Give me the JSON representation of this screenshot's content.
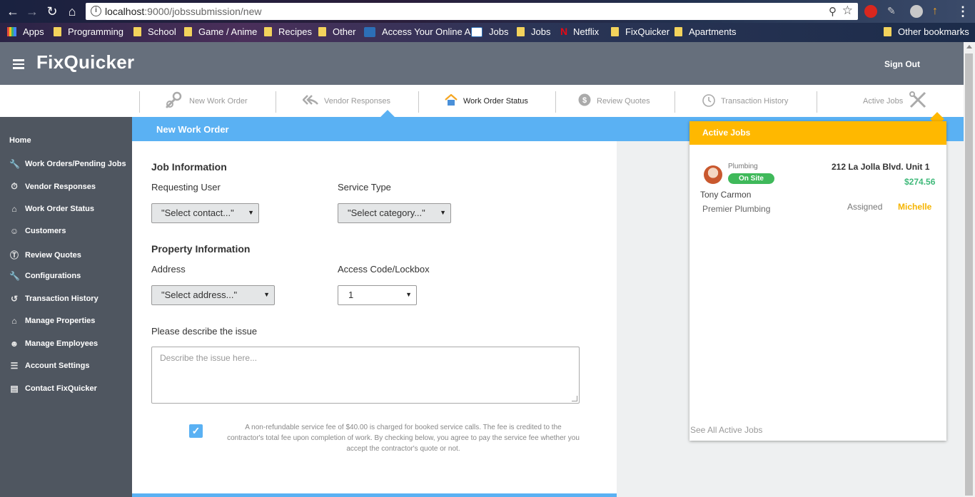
{
  "browser": {
    "url_host": "localhost",
    "url_rest": ":9000/jobssubmission/new",
    "bookmarks": [
      {
        "label": "Apps",
        "kind": "apps"
      },
      {
        "label": "Programming",
        "kind": "folder"
      },
      {
        "label": "School",
        "kind": "folder"
      },
      {
        "label": "Game / Anime",
        "kind": "folder"
      },
      {
        "label": "Recipes",
        "kind": "folder"
      },
      {
        "label": "Other",
        "kind": "folder"
      },
      {
        "label": "Access Your Online A",
        "kind": "site"
      },
      {
        "label": "Jobs",
        "kind": "site"
      },
      {
        "label": "Jobs",
        "kind": "folder"
      },
      {
        "label": "Netflix",
        "kind": "netflix"
      },
      {
        "label": "FixQuicker",
        "kind": "folder"
      },
      {
        "label": "Apartments",
        "kind": "folder"
      }
    ],
    "other_bookmarks": "Other bookmarks"
  },
  "header": {
    "brand": "FixQuicker",
    "sign_out": "Sign Out"
  },
  "tabs": [
    {
      "label": "New Work Order",
      "icon": "wrench-gear-icon",
      "active": false
    },
    {
      "label": "Vendor Responses",
      "icon": "reply-all-icon",
      "active": false
    },
    {
      "label": "Work Order Status",
      "icon": "house-icon",
      "active": true
    },
    {
      "label": "Review Quotes",
      "icon": "dollar-circle-icon",
      "active": false
    },
    {
      "label": "Transaction History",
      "icon": "history-icon",
      "active": false
    },
    {
      "label": "Active Jobs",
      "icon": "tools-icon",
      "active": false
    }
  ],
  "sidebar": {
    "items": [
      {
        "label": "Home",
        "icon": ""
      },
      {
        "label": "Work Orders/Pending Jobs",
        "icon": "wrench-icon"
      },
      {
        "label": "Vendor Responses",
        "icon": "stopwatch-icon"
      },
      {
        "label": "Work Order Status",
        "icon": "home-icon"
      },
      {
        "label": "Customers",
        "icon": "users-icon"
      },
      {
        "label": "Review Quotes",
        "icon": "dollar-icon"
      },
      {
        "label": "Configurations",
        "icon": "wrench-icon"
      },
      {
        "label": "Transaction History",
        "icon": "history-icon"
      },
      {
        "label": "Manage Properties",
        "icon": "building-icon"
      },
      {
        "label": "Manage Employees",
        "icon": "person-icon"
      },
      {
        "label": "Account Settings",
        "icon": "sliders-icon"
      },
      {
        "label": "Contact FixQuicker",
        "icon": "message-icon"
      }
    ]
  },
  "main": {
    "title": "New Work Order",
    "job_info": "Job Information",
    "requesting_user_label": "Requesting User",
    "requesting_user_value": "\"Select contact...\"",
    "service_type_label": "Service Type",
    "service_type_value": "\"Select category...\"",
    "property_info": "Property Information",
    "address_label": "Address",
    "address_value": "\"Select address...\"",
    "access_label": "Access Code/Lockbox",
    "access_value": "1",
    "describe_label": "Please describe the issue",
    "describe_placeholder": "Describe the issue here...",
    "fee_checked": true,
    "fee_text": "A non-refundable service fee of $40.00 is charged for booked service calls. The fee is credited to the contractor's total fee upon completion of work. By checking below, you agree to pay the service fee whether you accept the contractor's quote or not."
  },
  "active_jobs": {
    "title": "Active Jobs",
    "job": {
      "category": "Plumbing",
      "status": "On Site",
      "address": "212 La Jolla Blvd. Unit 1",
      "price": "$274.56",
      "customer": "Tony Carmon",
      "company": "Premier Plumbing",
      "assigned_label": "Assigned",
      "assigned_to": "Michelle"
    },
    "see_all": "See All Active Jobs"
  },
  "colors": {
    "accent_blue": "#5ab1f3",
    "active_jobs_yellow": "#ffb800",
    "status_green": "#3fb95a",
    "header_gray": "#666f7c",
    "sidebar_gray": "#4f5660"
  }
}
